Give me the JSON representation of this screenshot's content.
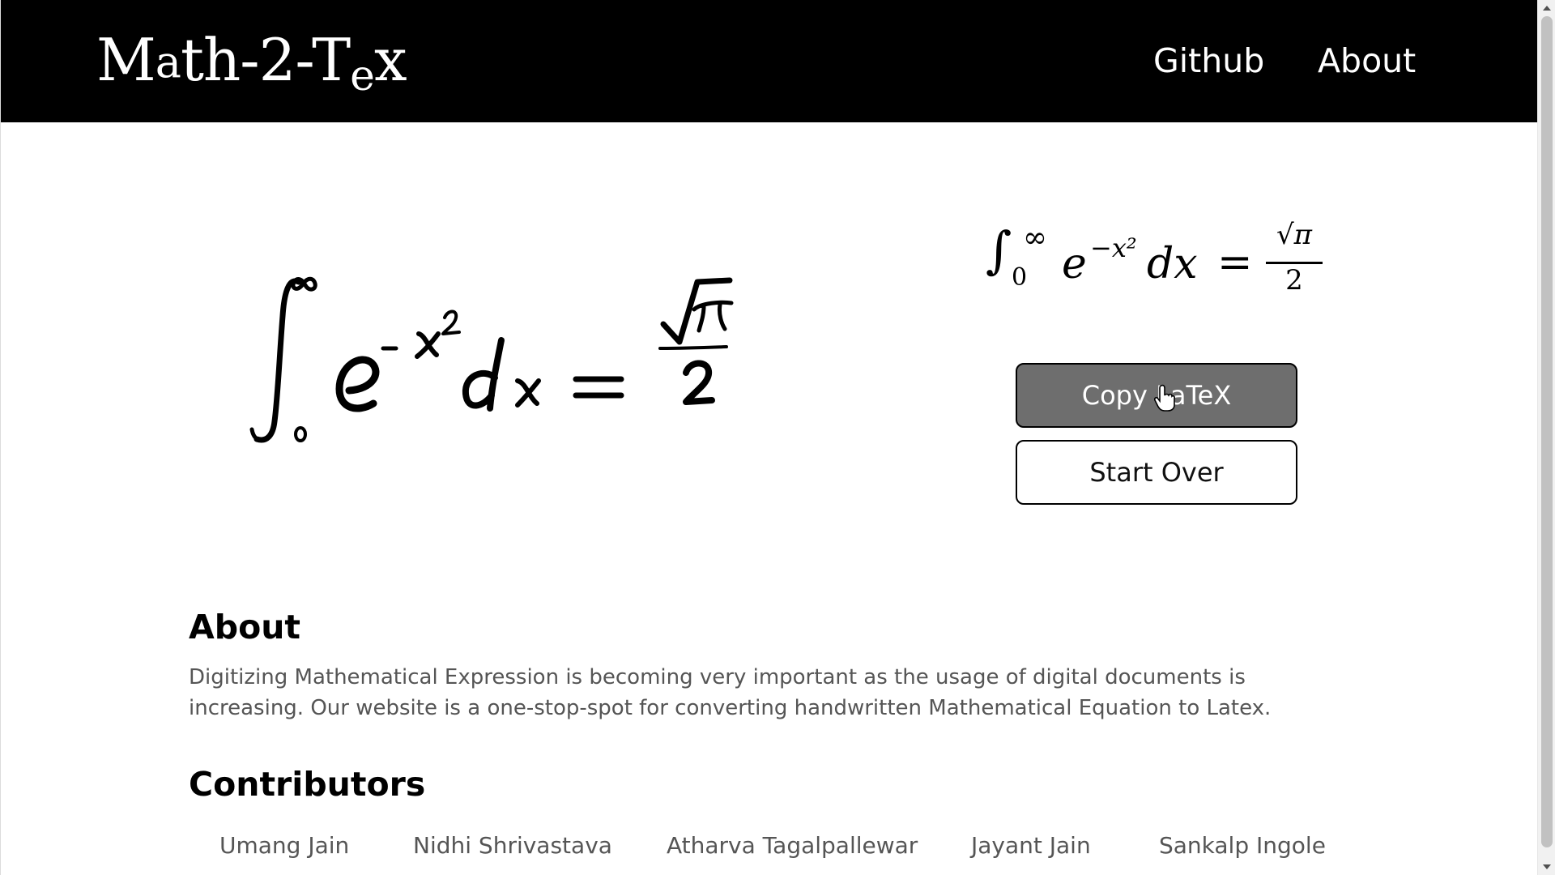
{
  "header": {
    "logo": {
      "m": "M",
      "a": "a",
      "th": "th-2-T",
      "e": "e",
      "x": "x"
    },
    "nav": [
      {
        "label": "Github"
      },
      {
        "label": "About"
      }
    ]
  },
  "result": {
    "latex": {
      "integral": "∫",
      "upper": "∞",
      "lower": "0",
      "base": "e",
      "exponent": "−x²",
      "dx": "dx",
      "equals": "=",
      "numerator": "√π",
      "denominator": "2"
    },
    "buttons": {
      "copy_label": "Copy LaTeX",
      "start_over_label": "Start Over"
    }
  },
  "about": {
    "title": "About",
    "text": "Digitizing Mathematical Expression is becoming very important as the usage of digital documents is increasing. Our website is a one-stop-spot for converting handwritten Mathematical Equation to Latex."
  },
  "contributors": {
    "title": "Contributors",
    "names": [
      "Umang Jain",
      "Nidhi Shrivastava",
      "Atharva Tagalpallewar",
      "Jayant Jain",
      "Sankalp Ingole"
    ]
  },
  "colors": {
    "header_bg": "#000000",
    "copy_button_bg": "#6e6e6e",
    "body_text": "#555555"
  }
}
